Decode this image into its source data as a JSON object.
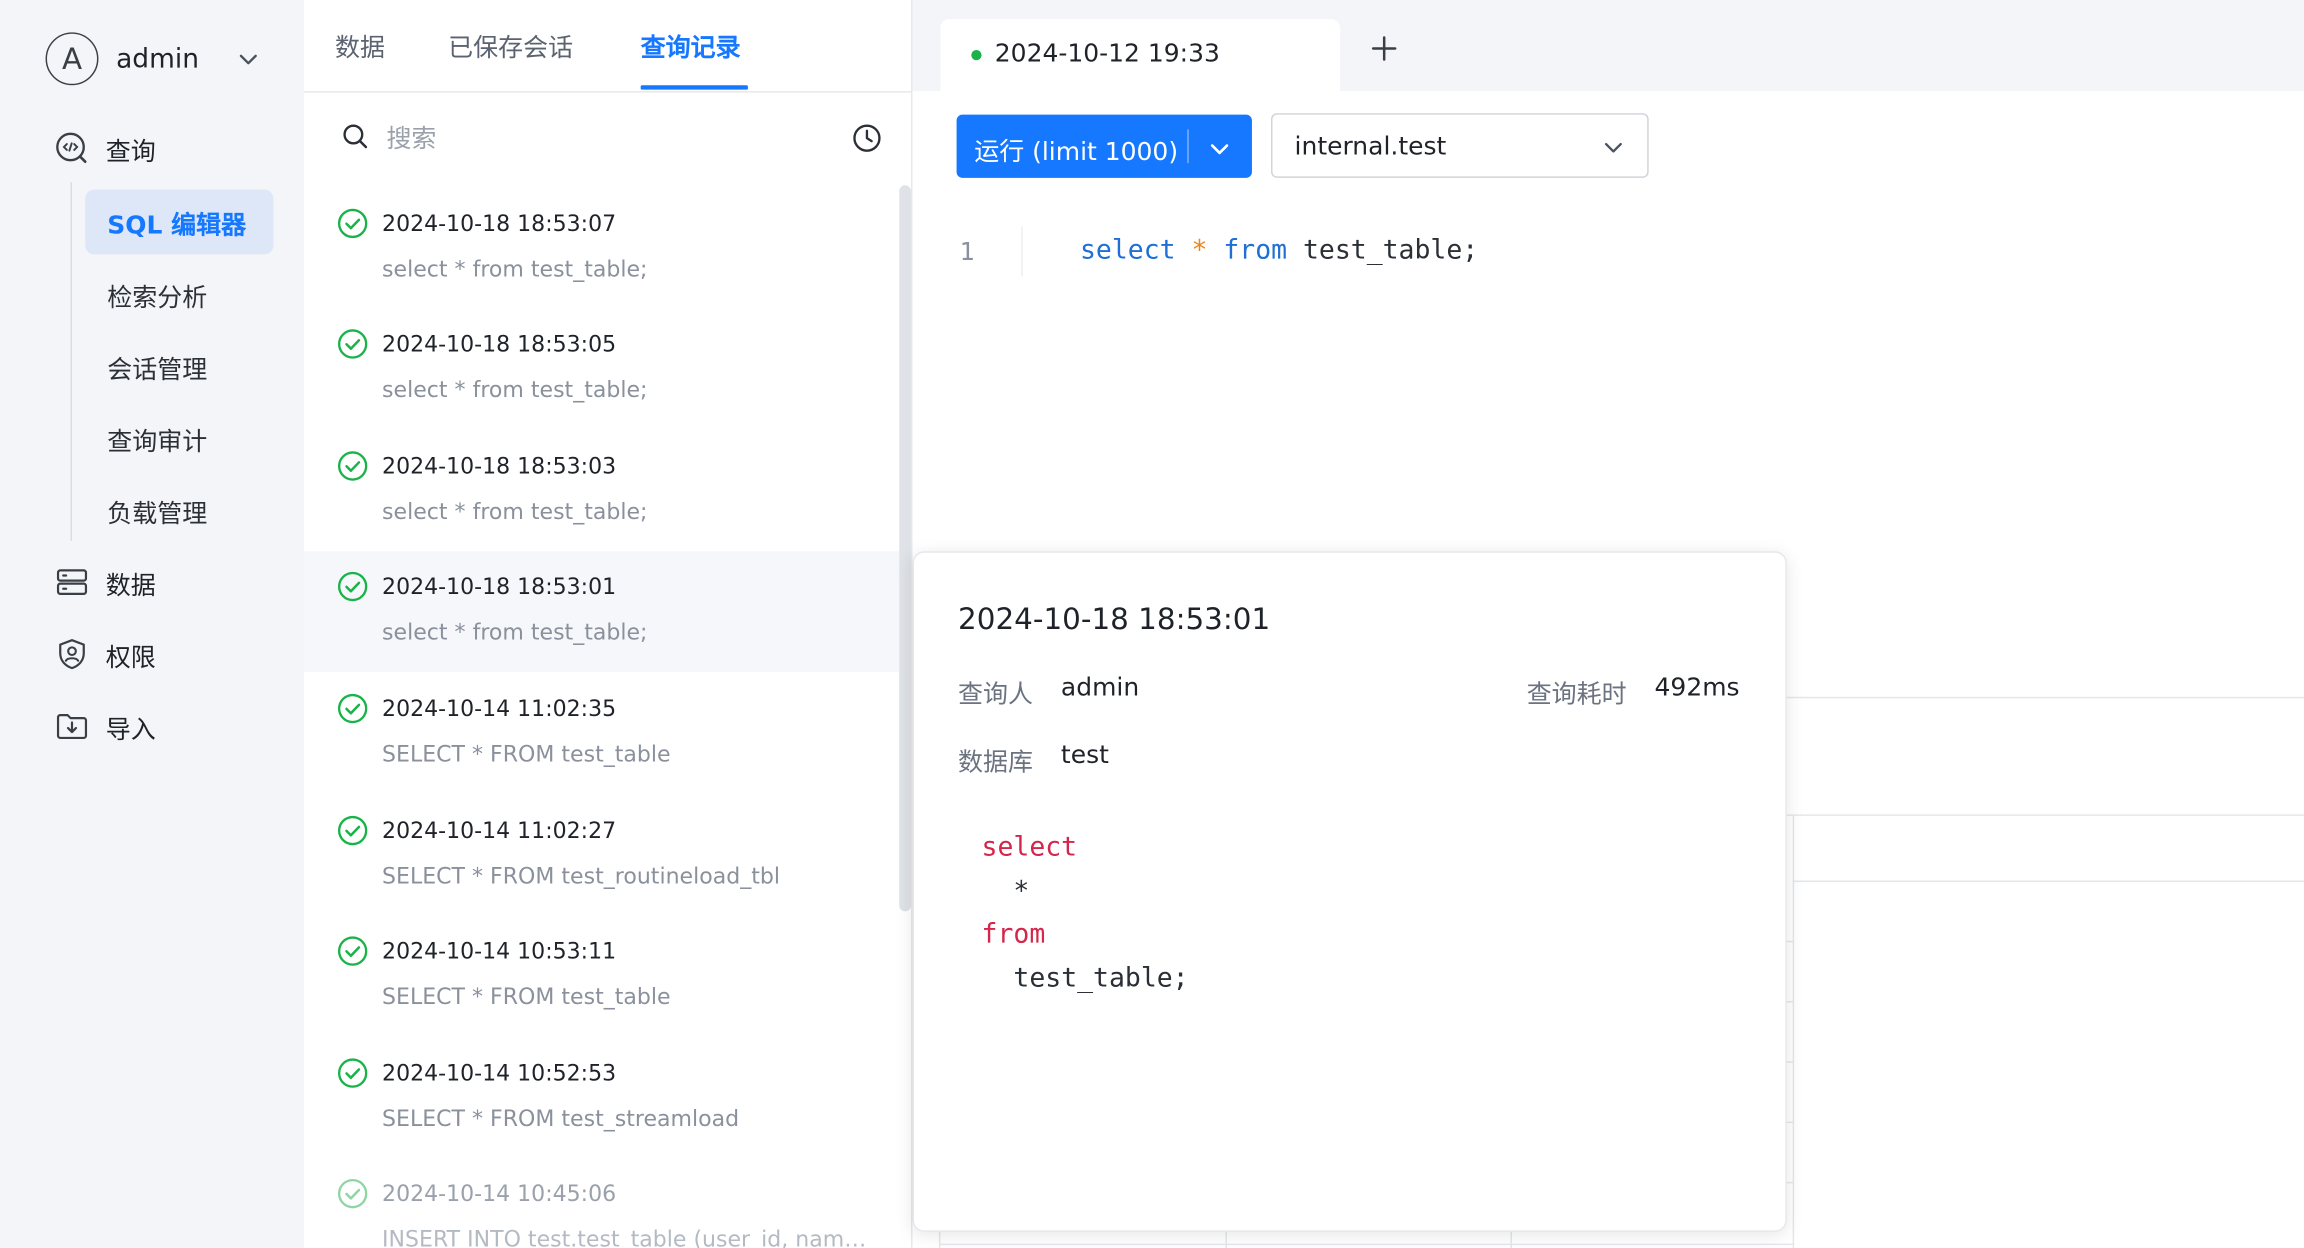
{
  "sidebar": {
    "user": {
      "avatar_letter": "A",
      "name": "admin"
    },
    "nav": {
      "query": "查询",
      "data": "数据",
      "permissions": "权限",
      "import": "导入"
    },
    "sub_items": [
      "SQL 编辑器",
      "检索分析",
      "会话管理",
      "查询审计",
      "负载管理"
    ]
  },
  "history_panel": {
    "tabs": [
      "数据",
      "已保存会话",
      "查询记录"
    ],
    "active_tab": "查询记录",
    "search": {
      "placeholder": "搜索",
      "value": ""
    },
    "items": [
      {
        "time": "2024-10-18 18:53:07",
        "query": "select * from test_table;",
        "status": "success"
      },
      {
        "time": "2024-10-18 18:53:05",
        "query": "select * from test_table;",
        "status": "success"
      },
      {
        "time": "2024-10-18 18:53:03",
        "query": "select * from test_table;",
        "status": "success"
      },
      {
        "time": "2024-10-18 18:53:01",
        "query": "select * from test_table;",
        "status": "success"
      },
      {
        "time": "2024-10-14 11:02:35",
        "query": "SELECT * FROM test_table",
        "status": "success"
      },
      {
        "time": "2024-10-14 11:02:27",
        "query": "SELECT * FROM test_routineload_tbl",
        "status": "success"
      },
      {
        "time": "2024-10-14 10:53:11",
        "query": "SELECT * FROM test_table",
        "status": "success"
      },
      {
        "time": "2024-10-14 10:52:53",
        "query": "SELECT * FROM test_streamload",
        "status": "success"
      },
      {
        "time": "2024-10-14 10:45:06",
        "query": "INSERT INTO test.test_table (user_id, name...",
        "status": "success"
      }
    ]
  },
  "editor": {
    "tab_title": "2024-10-12 19:33",
    "run_button": "运行 (limit 1000)",
    "database": "internal.test",
    "line_number": "1",
    "code": {
      "kw1": "select",
      "star": "*",
      "kw2": "from",
      "rest": "test_table;"
    }
  },
  "detail": {
    "time": "2024-10-18 18:53:01",
    "user_label": "查询人",
    "user": "admin",
    "duration_label": "查询耗时",
    "duration": "492ms",
    "db_label": "数据库",
    "db": "test",
    "sql": {
      "l1": "select",
      "l2": "*",
      "l3": "from",
      "l4": "test_table;"
    }
  },
  "colors": {
    "accent": "#1677ff",
    "success": "#19b34a",
    "sql_keyword": "#d4264b"
  },
  "icons": [
    "code-icon",
    "database-icon",
    "shield-user-icon",
    "import-folder-icon",
    "search-icon",
    "clock-icon",
    "check-circle-icon",
    "plus-icon",
    "chevron-down-icon"
  ]
}
